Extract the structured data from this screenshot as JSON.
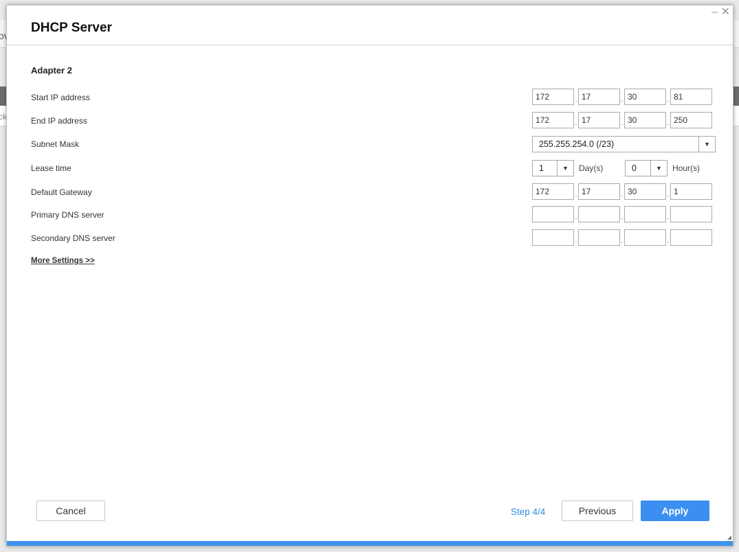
{
  "background": {
    "text_top": "ov",
    "text_mid": "ck"
  },
  "dialog": {
    "title": "DHCP Server",
    "section": "Adapter 2",
    "fields": {
      "start_ip": {
        "label": "Start IP address",
        "octets": [
          "172",
          "17",
          "30",
          "81"
        ]
      },
      "end_ip": {
        "label": "End IP address",
        "octets": [
          "172",
          "17",
          "30",
          "250"
        ]
      },
      "subnet": {
        "label": "Subnet Mask",
        "value": "255.255.254.0 (/23)"
      },
      "lease": {
        "label": "Lease time",
        "days": "1",
        "days_unit": "Day(s)",
        "hours": "0",
        "hours_unit": "Hour(s)"
      },
      "gateway": {
        "label": "Default Gateway",
        "octets": [
          "172",
          "17",
          "30",
          "1"
        ]
      },
      "primary_dns": {
        "label": "Primary DNS server",
        "octets": [
          "",
          "",
          "",
          ""
        ]
      },
      "secondary_dns": {
        "label": "Secondary DNS server",
        "octets": [
          "",
          "",
          "",
          ""
        ]
      }
    },
    "more_settings": "More Settings >>",
    "footer": {
      "cancel": "Cancel",
      "step": "Step 4/4",
      "previous": "Previous",
      "apply": "Apply"
    },
    "icons": {
      "minimize": "minimize-icon",
      "close": "close-icon",
      "dropdown": "chevron-down-icon"
    }
  },
  "colors": {
    "accent": "#3b8ff0",
    "step_text": "#2d8ee0",
    "progress": "#3d93ee"
  }
}
